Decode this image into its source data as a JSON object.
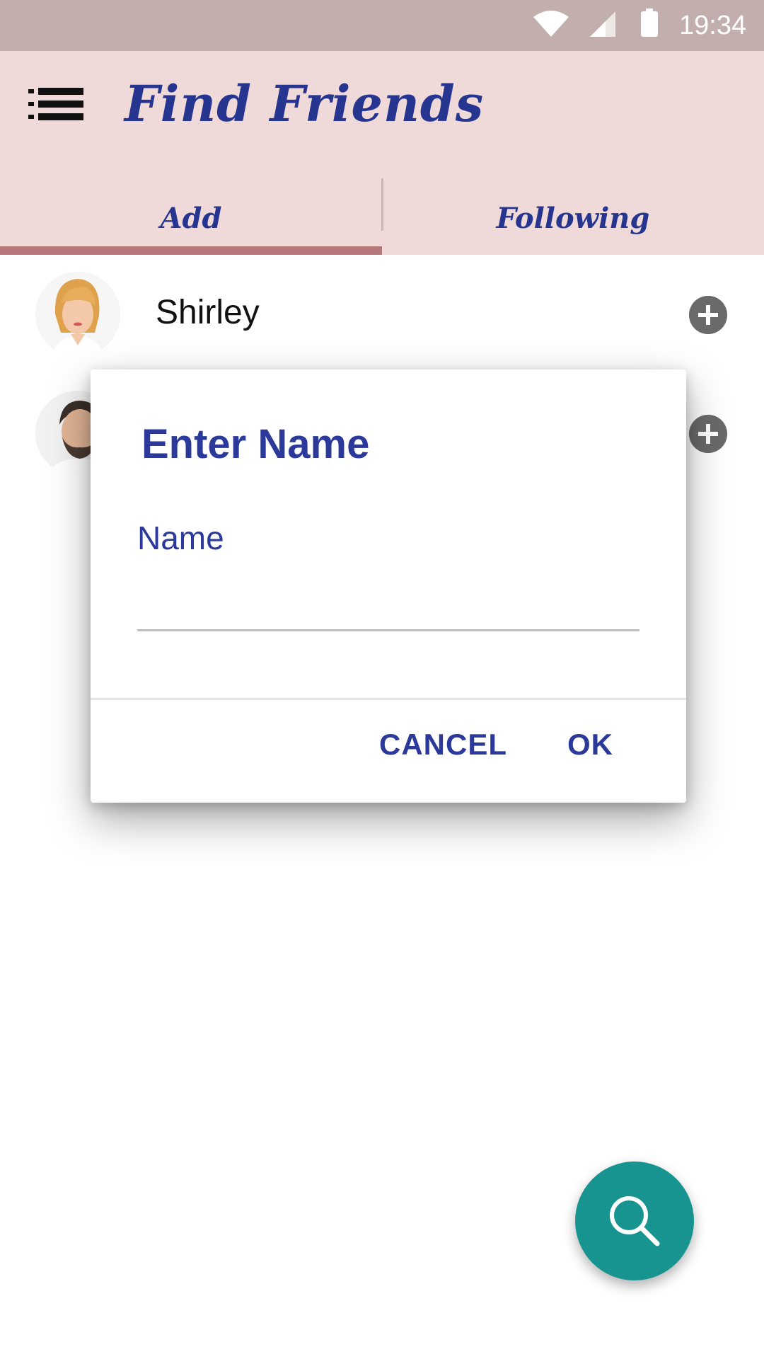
{
  "status_bar": {
    "time": "19:34",
    "icons": [
      "wifi-icon",
      "signal-icon",
      "battery-icon"
    ]
  },
  "app_bar": {
    "title": "Find Friends",
    "menu_icon": "menu-list-icon",
    "tabs": [
      {
        "label": "Add",
        "selected": true
      },
      {
        "label": "Following",
        "selected": false
      }
    ]
  },
  "friends": [
    {
      "name": "Shirley",
      "action_icon": "add-circle-icon"
    },
    {
      "name": "",
      "action_icon": "add-circle-icon"
    }
  ],
  "dialog": {
    "title": "Enter Name",
    "field_label": "Name",
    "field_value": "",
    "cancel_label": "CANCEL",
    "ok_label": "OK"
  },
  "fab": {
    "icon": "search-icon"
  },
  "colors": {
    "status_bar": "#c2aeac",
    "app_bar": "#f0d9d9",
    "accent_text": "#26358f",
    "tab_indicator": "#b57777",
    "fab": "#179390"
  }
}
